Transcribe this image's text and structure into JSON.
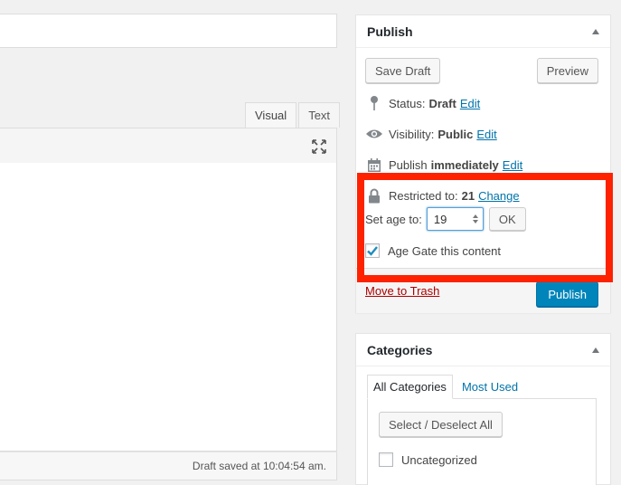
{
  "editor": {
    "tabs": [
      "Visual",
      "Text"
    ],
    "draft_saved": "Draft saved at 10:04:54 am."
  },
  "publish": {
    "title": "Publish",
    "save_draft": "Save Draft",
    "preview": "Preview",
    "status_label": "Status:",
    "status_value": "Draft",
    "status_edit": "Edit",
    "visibility_label": "Visibility:",
    "visibility_value": "Public",
    "visibility_edit": "Edit",
    "publish_label": "Publish",
    "publish_value": "immediately",
    "publish_edit": "Edit",
    "restricted_label": "Restricted to:",
    "restricted_value": "21",
    "restricted_change": "Change",
    "set_age_label": "Set age to:",
    "age_value": "19",
    "ok": "OK",
    "age_gate_label": "Age Gate this content",
    "age_gate_checked": true,
    "move_to_trash": "Move to Trash",
    "publish_button": "Publish"
  },
  "categories": {
    "title": "Categories",
    "tabs": [
      "All Categories",
      "Most Used"
    ],
    "select_deselect": "Select / Deselect All",
    "items": [
      {
        "label": "Uncategorized",
        "checked": false
      }
    ]
  },
  "colors": {
    "highlight": "#ff2200",
    "link": "#0073aa",
    "primary": "#0085ba",
    "trash": "#a00000"
  }
}
